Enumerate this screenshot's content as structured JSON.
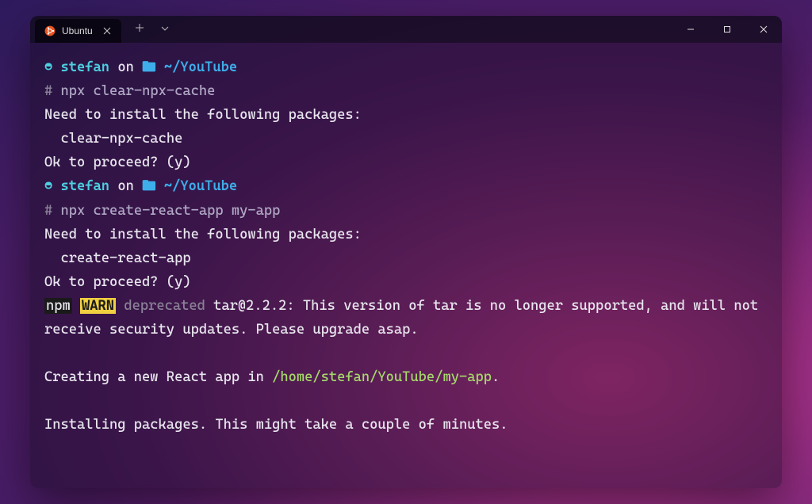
{
  "titlebar": {
    "tab_title": "Ubuntu"
  },
  "prompt1": {
    "user": "stefan",
    "on": "on",
    "path": "~/YouTube"
  },
  "cmd1": {
    "hash": "#",
    "command": "npx clear-npx-cache"
  },
  "out1": {
    "need": "Need to install the following packages:",
    "pkg": "  clear-npx-cache",
    "ok": "Ok to proceed? (y)"
  },
  "prompt2": {
    "user": "stefan",
    "on": "on",
    "path": "~/YouTube"
  },
  "cmd2": {
    "hash": "#",
    "command": "npx create-react-app my-app"
  },
  "out2": {
    "need": "Need to install the following packages:",
    "pkg": "  create-react-app",
    "ok": "Ok to proceed? (y)"
  },
  "warn": {
    "npm": "npm",
    "warn": "WARN",
    "deprecated": "deprecated",
    "msg": "tar@2.2.2: This version of tar is no longer supported, and will not receive security updates. Please upgrade asap."
  },
  "creating": {
    "pre": "Creating a new React app in ",
    "path": "/home/stefan/YouTube/my-app",
    "dot": "."
  },
  "installing": "Installing packages. This might take a couple of minutes."
}
